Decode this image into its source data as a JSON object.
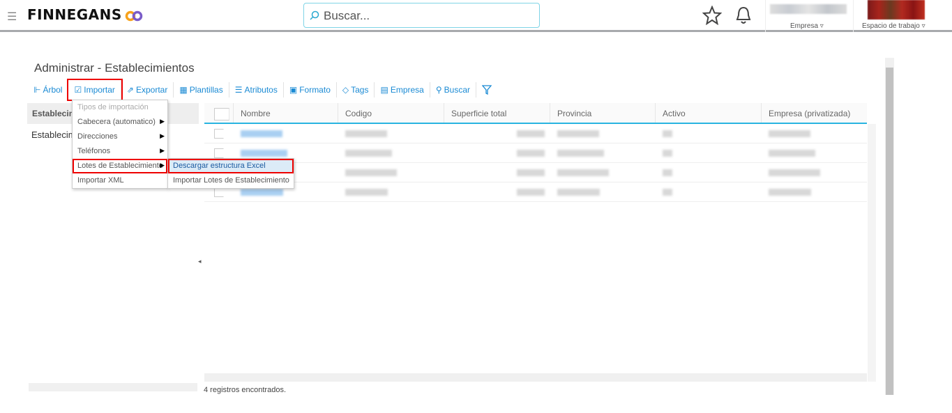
{
  "header": {
    "logo": "FINNEGANS",
    "search_placeholder": "Buscar...",
    "empresa_label": "Empresa",
    "workspace_label": "Espacio de trabajo"
  },
  "page": {
    "title": "Administrar - Establecimientos"
  },
  "toolbar": [
    {
      "label": "Árbol",
      "icon": "tree-icon"
    },
    {
      "label": "Importar",
      "icon": "import-icon"
    },
    {
      "label": "Exportar",
      "icon": "export-icon"
    },
    {
      "label": "Plantillas",
      "icon": "template-icon"
    },
    {
      "label": "Atributos",
      "icon": "list-icon"
    },
    {
      "label": "Formato",
      "icon": "format-icon"
    },
    {
      "label": "Tags",
      "icon": "tag-icon"
    },
    {
      "label": "Empresa",
      "icon": "building-icon"
    },
    {
      "label": "Buscar",
      "icon": "search-icon"
    }
  ],
  "tree": {
    "header": "Establecimientos",
    "item": "Establecimientos"
  },
  "import_menu": {
    "header": "Tipos de importación",
    "items": [
      "Cabecera (automatico)",
      "Direcciones",
      "Teléfonos",
      "Lotes de Establecimiento",
      "Importar XML"
    ]
  },
  "submenu": {
    "items": [
      "Descargar estructura Excel",
      "Importar Lotes de Establecimiento"
    ]
  },
  "grid": {
    "columns": [
      "Nombre",
      "Codigo",
      "Superficie total",
      "Provincia",
      "Activo",
      "Empresa (privatizada)"
    ],
    "row_count": 4
  },
  "status": "4 registros encontrados.",
  "colors": {
    "accent": "#1a8ad4",
    "highlight": "#e00000",
    "header_line": "#28b4e0"
  }
}
